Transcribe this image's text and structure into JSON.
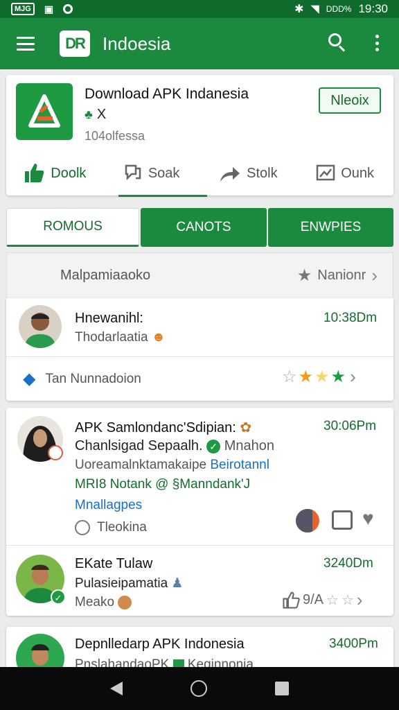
{
  "status_bar": {
    "left_badge": "MJG",
    "left_icon": "tv-icon",
    "battery_text": "DDD%",
    "time": "19:30"
  },
  "app_bar": {
    "logo_text": "DR",
    "title": "Indoesia"
  },
  "app": {
    "name": "Download APK Indanesia",
    "sub": "X",
    "count": "104olfessa",
    "install_label": "Nleoix",
    "actions": [
      "Doolk",
      "Soak",
      "Stolk",
      "Ounk"
    ]
  },
  "tabs": [
    "ROMOUS",
    "CANOTS",
    "ENWPIES"
  ],
  "section": {
    "title": "Malpamiaaoko",
    "right_label": "Nanionr"
  },
  "post1": {
    "name": "Hnewanihl:",
    "time": "10:38Dm",
    "line1": "Thodarlaatia",
    "footer_text": "Tan Nunnadoion"
  },
  "post2": {
    "name": "APK Samlondanc'Sdipian:",
    "time": "30:06Pm",
    "line1": "Chanlsigad Sepaalh.",
    "line1_suffix": "Mnahon",
    "line2": "Uoreamalnktamakaipe",
    "line2_link": "Beirotannl",
    "line3": "MRI8 Notank",
    "line3_suffix": "@ §Manndank'J",
    "line4": "Mnallagpes",
    "comment_label": "Tleokina",
    "sub_name": "EKate Tulaw",
    "sub_time": "3240Dm",
    "sub_line1": "Pulasieipamatia",
    "sub_line2": "Meako",
    "sub_rating": "9/A"
  },
  "post3": {
    "name": "Depnlledarp APK Indonesia",
    "time": "3400Pm",
    "line1": "PnslahandaoPK",
    "line1_suffix": "Keginnonia"
  }
}
